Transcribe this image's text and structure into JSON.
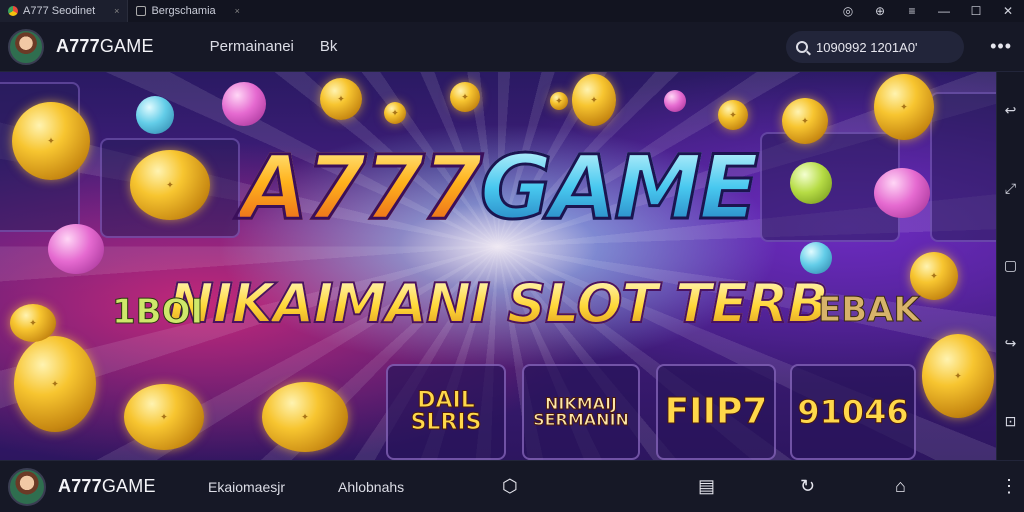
{
  "tabs": [
    {
      "label": "A777 Seodinet",
      "close": "×"
    },
    {
      "label": "Bergschamia",
      "close": "×"
    }
  ],
  "window_controls": {
    "a": "◎",
    "b": "⊕",
    "menu": "≡",
    "min": "—",
    "max": "☐",
    "close": "✕"
  },
  "header": {
    "brand_bold": "A777",
    "brand_rest": "GAME",
    "nav": [
      "Permainanei",
      "Bk"
    ],
    "search_value": "1090992 1201A0'",
    "more": "•••"
  },
  "banner": {
    "title_a": "A777",
    "title_b": "GAME",
    "subtitle": "NIKAIMANI SLOT TERB",
    "side_left": "1BOI",
    "side_right": "EBAK",
    "cards": [
      {
        "text": "DAIL SLRIS"
      },
      {
        "text": "NIKMAIJ SERMANIN"
      },
      {
        "text": "FIIP7"
      },
      {
        "text": "91046"
      }
    ]
  },
  "rail_icons": [
    "↩",
    "⤢",
    "▢",
    "↪",
    "⊡"
  ],
  "bottom": {
    "brand_bold": "A777",
    "brand_rest": "GAME",
    "nav": [
      "Ekaiomaesjr",
      "Ahlobnahs"
    ],
    "icons": [
      "⬡",
      "▤",
      "↻",
      "⌂",
      "⋮"
    ]
  },
  "colors": {
    "accent_gold": "#ffd737",
    "accent_blue": "#48c8ef",
    "bg_purple": "#4a1f86"
  }
}
